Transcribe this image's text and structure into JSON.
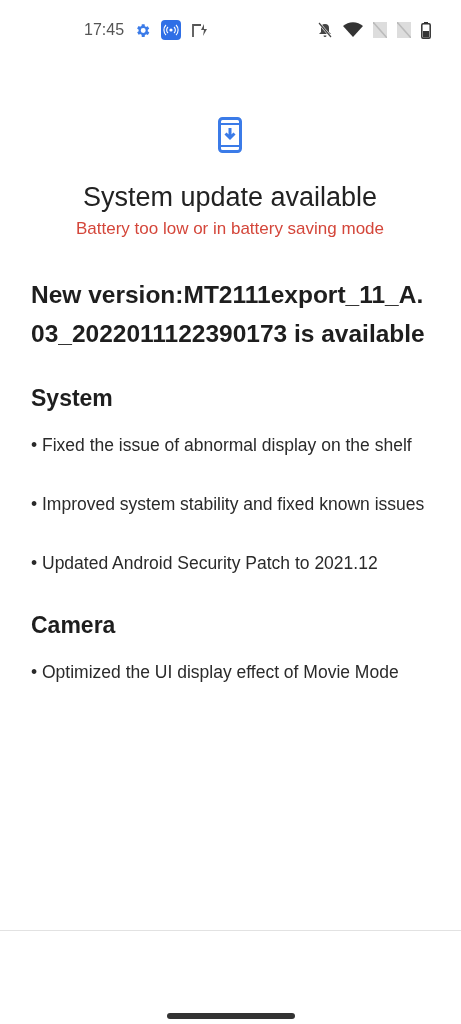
{
  "status_bar": {
    "time": "17:45"
  },
  "header": {
    "title": "System update available",
    "warning": "Battery too low or in battery saving mode"
  },
  "release_notes": {
    "heading": "New version:MT2111export_11_A.03_2022011122390173 is available",
    "sections": [
      {
        "title": "System",
        "items": [
          "• Fixed the issue of abnormal display on the shelf",
          "• Improved system stability and fixed known issues",
          "• Updated Android Security Patch to 2021.12"
        ]
      },
      {
        "title": "Camera",
        "items": [
          "• Optimized the UI display effect of Movie Mode"
        ]
      }
    ]
  }
}
